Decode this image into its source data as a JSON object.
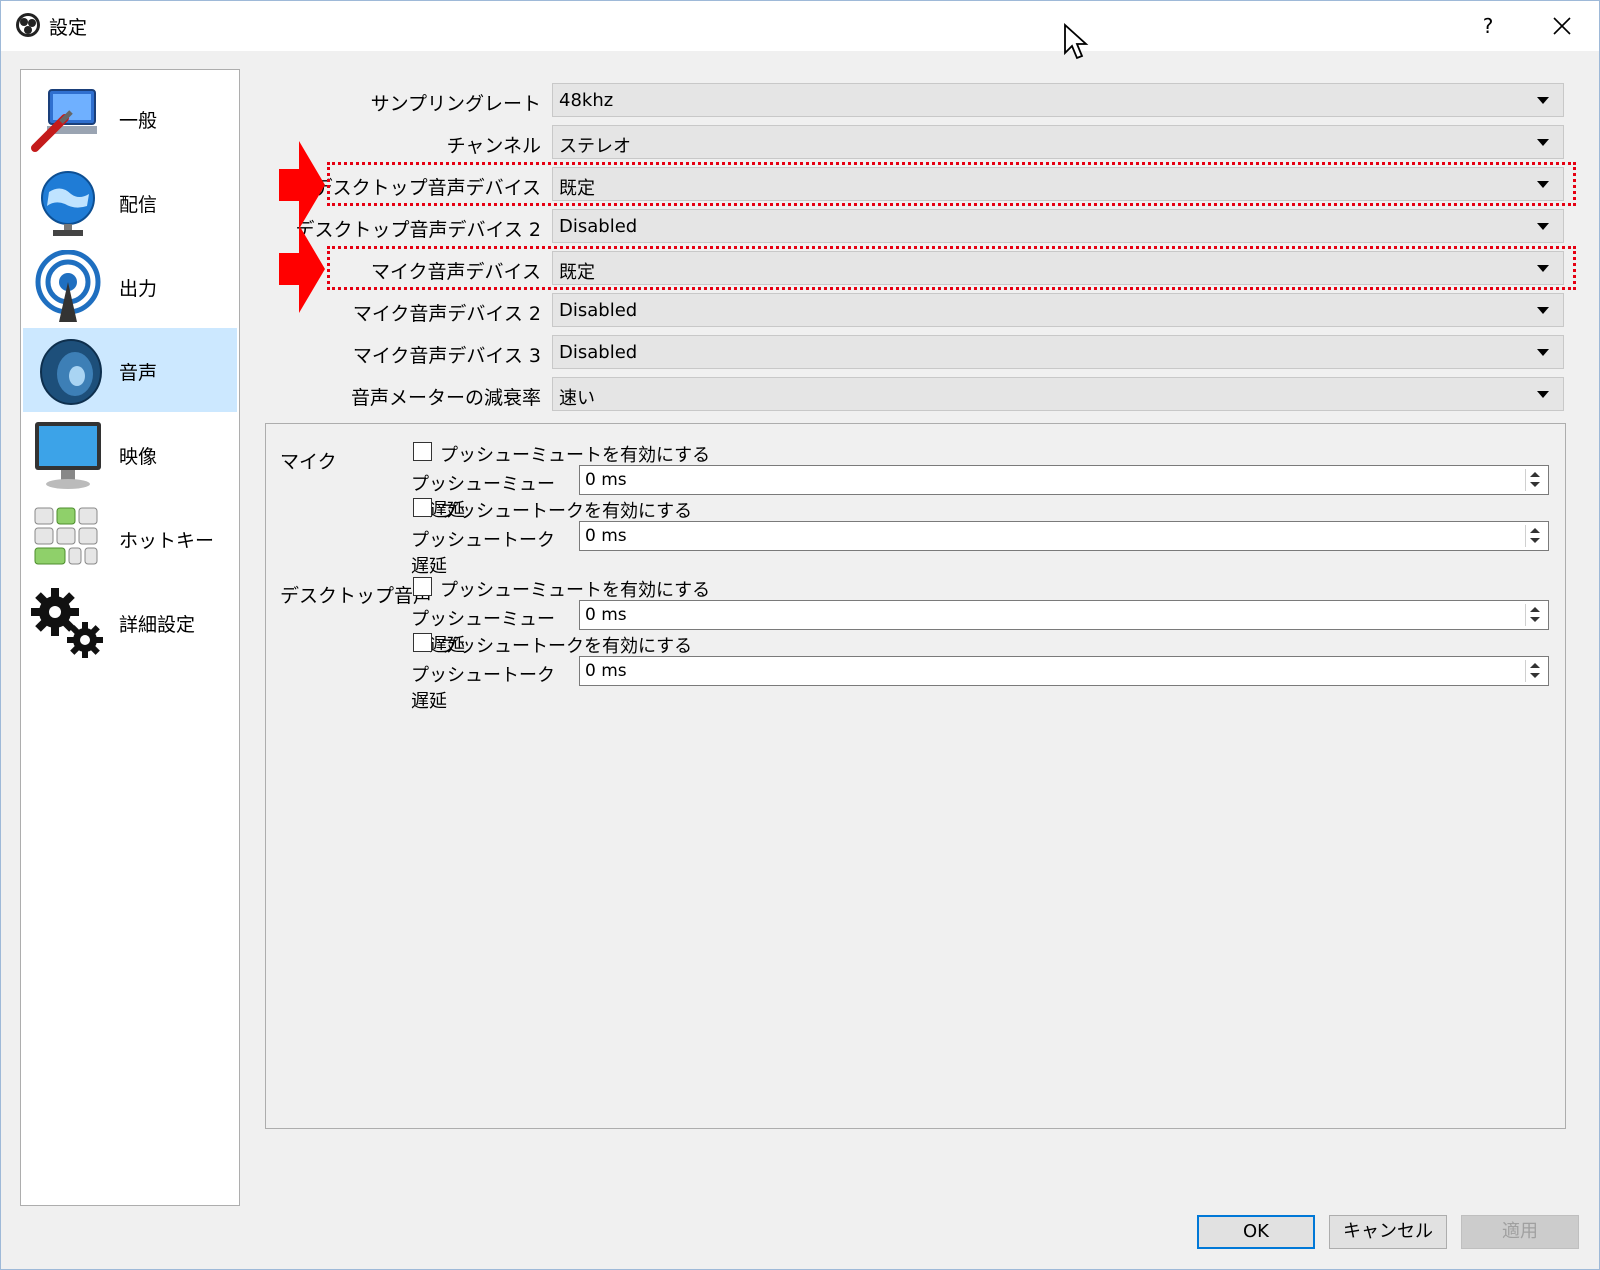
{
  "window": {
    "title": "設定",
    "help": "?"
  },
  "sidebar": {
    "items": [
      {
        "label": "一般",
        "icon": "general-icon"
      },
      {
        "label": "配信",
        "icon": "stream-globe-icon"
      },
      {
        "label": "出力",
        "icon": "output-antenna-icon"
      },
      {
        "label": "音声",
        "icon": "audio-speaker-icon",
        "selected": true
      },
      {
        "label": "映像",
        "icon": "video-monitor-icon"
      },
      {
        "label": "ホットキー",
        "icon": "hotkeys-icon"
      },
      {
        "label": "詳細設定",
        "icon": "advanced-gears-icon"
      }
    ]
  },
  "audio": {
    "rows": [
      {
        "label": "サンプリングレート",
        "value": "48khz"
      },
      {
        "label": "チャンネル",
        "value": "ステレオ"
      },
      {
        "label": "デスクトップ音声デバイス",
        "value": "既定"
      },
      {
        "label": "デスクトップ音声デバイス 2",
        "value": "Disabled"
      },
      {
        "label": "マイク音声デバイス",
        "value": "既定"
      },
      {
        "label": "マイク音声デバイス 2",
        "value": "Disabled"
      },
      {
        "label": "マイク音声デバイス 3",
        "value": "Disabled"
      },
      {
        "label": "音声メーターの減衰率",
        "value": "速い"
      }
    ]
  },
  "hotkeys": {
    "mic": {
      "label": "マイク",
      "push_mute_checkbox": "プッシューミュートを有効にする",
      "push_mute_delay_label": "プッシューミュート遅延",
      "push_mute_delay_value": "0 ms",
      "push_talk_checkbox": "プッシュートークを有効にする",
      "push_talk_delay_label": "プッシュートーク遅延",
      "push_talk_delay_value": "0 ms"
    },
    "desktop": {
      "label": "デスクトップ音声",
      "push_mute_checkbox": "プッシューミュートを有効にする",
      "push_mute_delay_label": "プッシューミュート遅延",
      "push_mute_delay_value": "0 ms",
      "push_talk_checkbox": "プッシュートークを有効にする",
      "push_talk_delay_label": "プッシュートーク遅延",
      "push_talk_delay_value": "0 ms"
    }
  },
  "buttons": {
    "ok": "OK",
    "cancel": "キャンセル",
    "apply": "適用"
  },
  "colors": {
    "highlight": "#e60012",
    "selected": "#cce8ff",
    "ok_border": "#0078d7"
  }
}
